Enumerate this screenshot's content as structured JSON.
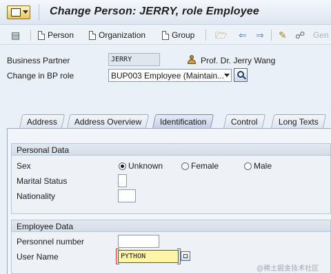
{
  "window": {
    "title": "Change Person: JERRY, role Employee"
  },
  "toolbar": {
    "person_label": "Person",
    "organization_label": "Organization",
    "group_label": "Group",
    "generic_label": "Gen"
  },
  "header": {
    "business_partner_label": "Business Partner",
    "business_partner_value": "JERRY",
    "partner_name": "Prof. Dr. Jerry Wang",
    "bp_role_label": "Change in BP role",
    "bp_role_value": "BUP003 Employee (Maintain..."
  },
  "tabs": [
    "Address",
    "Address Overview",
    "Identification",
    "Control",
    "Long Texts"
  ],
  "active_tab": "Identification",
  "personal_data": {
    "title": "Personal Data",
    "sex_label": "Sex",
    "sex_options": [
      "Unknown",
      "Female",
      "Male"
    ],
    "sex_selected": "Unknown",
    "marital_status_label": "Marital Status",
    "nationality_label": "Nationality"
  },
  "employee_data": {
    "title": "Employee Data",
    "personnel_number_label": "Personnel number",
    "personnel_number_value": "",
    "user_name_label": "User Name",
    "user_name_value": "PYTHON"
  },
  "watermark": "@稀土掘金技术社区",
  "colors": {
    "focus_field": "#fff4a8",
    "highlight_marker": "#e0312b"
  }
}
